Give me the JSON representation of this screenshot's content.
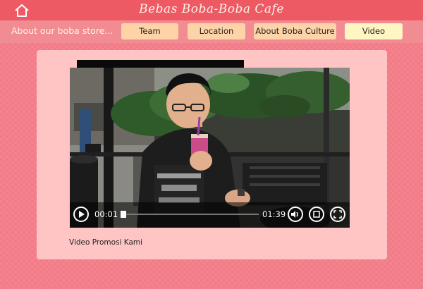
{
  "header": {
    "title": "Bebas Boba-Boba Cafe",
    "home_icon": "home-icon"
  },
  "nav": {
    "caption": "About our boba store...",
    "items": [
      {
        "label": "Team",
        "active": false
      },
      {
        "label": "Location",
        "active": false
      },
      {
        "label": "About Boba Culture",
        "active": false
      },
      {
        "label": "Video",
        "active": true
      }
    ]
  },
  "video": {
    "current_time": "00:01",
    "duration": "01:39",
    "progress": 0.01,
    "caption": "Video Promosi Kami",
    "icons": [
      "play-icon",
      "volume-icon",
      "crop-screen-icon",
      "fullscreen-icon"
    ]
  },
  "colors": {
    "topbar": "#ee5a63",
    "navbar": "#f28c93",
    "nav_button": "#ffd3a8",
    "nav_button_active": "#fff6c3",
    "card": "#ffc4c4"
  }
}
